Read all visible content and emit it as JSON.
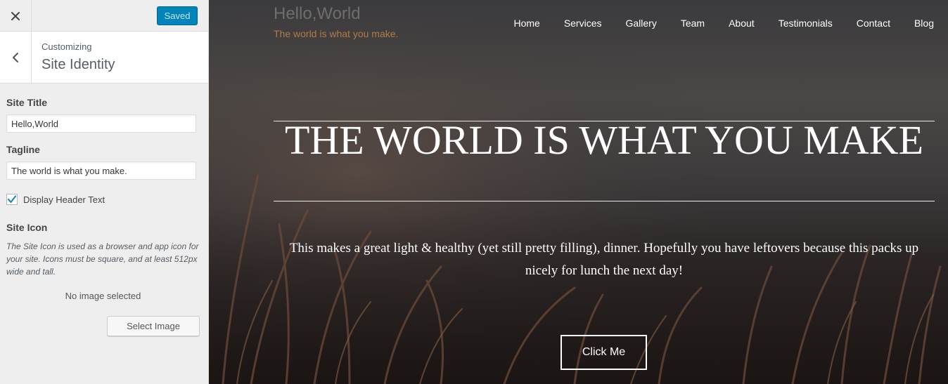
{
  "sidebar": {
    "close_icon": "close-icon",
    "saved_label": "Saved",
    "back_icon": "chevron-left-icon",
    "customizing_label": "Customizing",
    "section_title": "Site Identity",
    "site_title_label": "Site Title",
    "site_title_value": "Hello,World",
    "tagline_label": "Tagline",
    "tagline_value": "The world is what you make.",
    "display_header_text_label": "Display Header Text",
    "display_header_text_checked": true,
    "site_icon_label": "Site Icon",
    "site_icon_description": "The Site Icon is used as a browser and app icon for your site. Icons must be square, and at least 512px wide and tall.",
    "no_image_text": "No image selected",
    "select_image_label": "Select Image",
    "accent_color": "#0085ba"
  },
  "preview": {
    "site_title": "Hello,World",
    "tagline": "The world is what you make.",
    "nav": [
      "Home",
      "Services",
      "Gallery",
      "Team",
      "About",
      "Testimonials",
      "Contact",
      "Blog"
    ],
    "headline": "THE WORLD IS WHAT YOU MAKE",
    "subtext": "This makes a great light & healthy (yet still pretty filling), dinner. Hopefully you have leftovers because this packs up nicely for lunch the next day!",
    "cta_label": "Click Me",
    "tagline_color": "#b47a43"
  }
}
